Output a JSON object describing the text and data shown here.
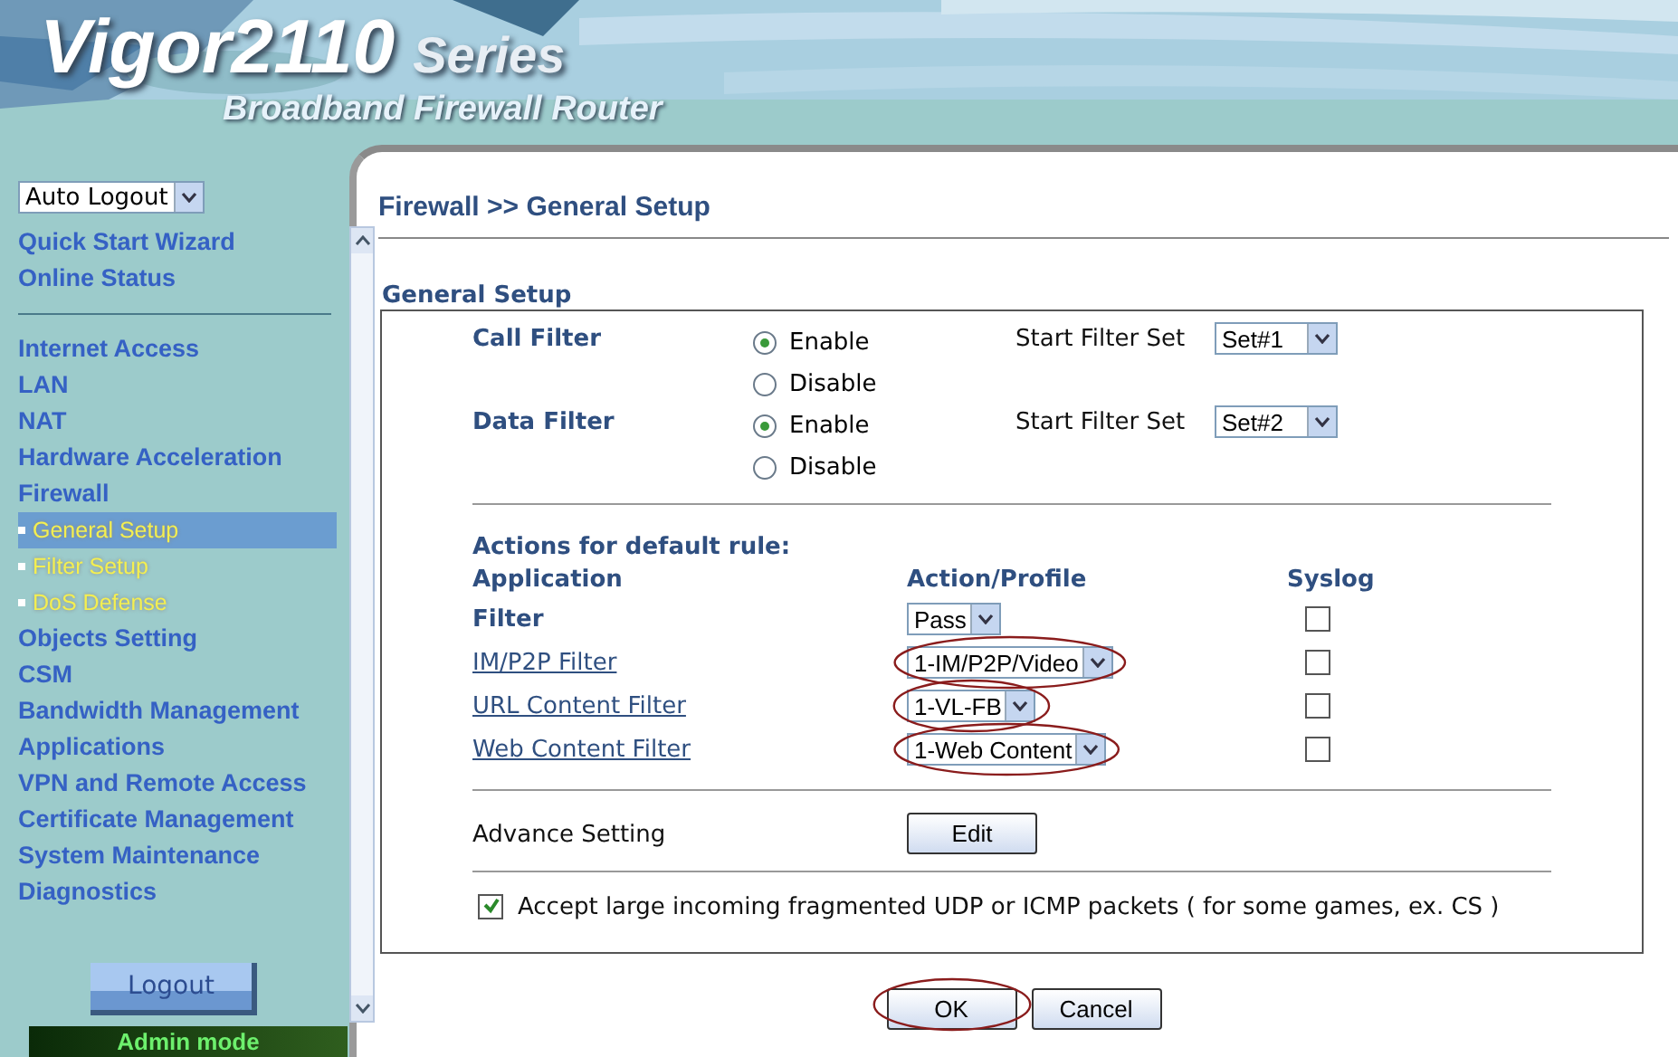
{
  "header": {
    "logo": "Vigor2110",
    "series": "Series",
    "tagline": "Broadband Firewall Router"
  },
  "sidebar": {
    "auto_logout": "Auto Logout",
    "quick_links": [
      {
        "label": "Quick Start Wizard",
        "selected": false
      },
      {
        "label": "Online Status",
        "selected": false
      }
    ],
    "items": [
      {
        "label": "Internet Access",
        "selected": false
      },
      {
        "label": "LAN",
        "selected": false
      },
      {
        "label": "NAT",
        "selected": false
      },
      {
        "label": "Hardware Acceleration",
        "selected": false
      },
      {
        "label": "Firewall",
        "selected": false,
        "children": [
          {
            "label": "General Setup",
            "selected": true
          },
          {
            "label": "Filter Setup",
            "selected": false
          },
          {
            "label": "DoS Defense",
            "selected": false
          }
        ]
      },
      {
        "label": "Objects Setting",
        "selected": false
      },
      {
        "label": "CSM",
        "selected": false
      },
      {
        "label": "Bandwidth Management",
        "selected": false
      },
      {
        "label": "Applications",
        "selected": false
      },
      {
        "label": "VPN and Remote Access",
        "selected": false
      },
      {
        "label": "Certificate Management",
        "selected": false
      },
      {
        "label": "System Maintenance",
        "selected": false
      },
      {
        "label": "Diagnostics",
        "selected": false
      }
    ],
    "logout": "Logout",
    "mode": "Admin mode"
  },
  "page": {
    "breadcrumb": "Firewall >> General Setup",
    "section": "General Setup",
    "filters": [
      {
        "label": "Call Filter",
        "options": [
          {
            "label": "Enable",
            "selected": true
          },
          {
            "label": "Disable",
            "selected": false
          }
        ],
        "set_label": "Start Filter Set",
        "set_value": "Set#1"
      },
      {
        "label": "Data Filter",
        "options": [
          {
            "label": "Enable",
            "selected": true
          },
          {
            "label": "Disable",
            "selected": false
          }
        ],
        "set_label": "Start Filter Set",
        "set_value": "Set#2"
      }
    ],
    "actions_title": "Actions for default rule:",
    "columns": [
      "Application",
      "Action/Profile",
      "Syslog"
    ],
    "rows": [
      {
        "kind": "plain",
        "label": "Filter",
        "profile": "Pass",
        "syslog": false,
        "circled": false
      },
      {
        "kind": "link",
        "label": "IM/P2P Filter",
        "profile": "1-IM/P2P/Video",
        "syslog": false,
        "circled": true
      },
      {
        "kind": "link",
        "label": "URL Content Filter",
        "profile": "1-VL-FB",
        "syslog": false,
        "circled": true
      },
      {
        "kind": "link",
        "label": "Web Content Filter",
        "profile": "1-Web Content",
        "syslog": false,
        "circled": true
      }
    ],
    "advance_label": "Advance Setting",
    "edit_button": "Edit",
    "accept_fragmented": {
      "label": "Accept large incoming fragmented UDP or ICMP packets ( for some games, ex. CS )",
      "checked": true
    },
    "buttons": [
      {
        "label": "OK",
        "circled": true
      },
      {
        "label": "Cancel",
        "circled": false
      }
    ]
  }
}
